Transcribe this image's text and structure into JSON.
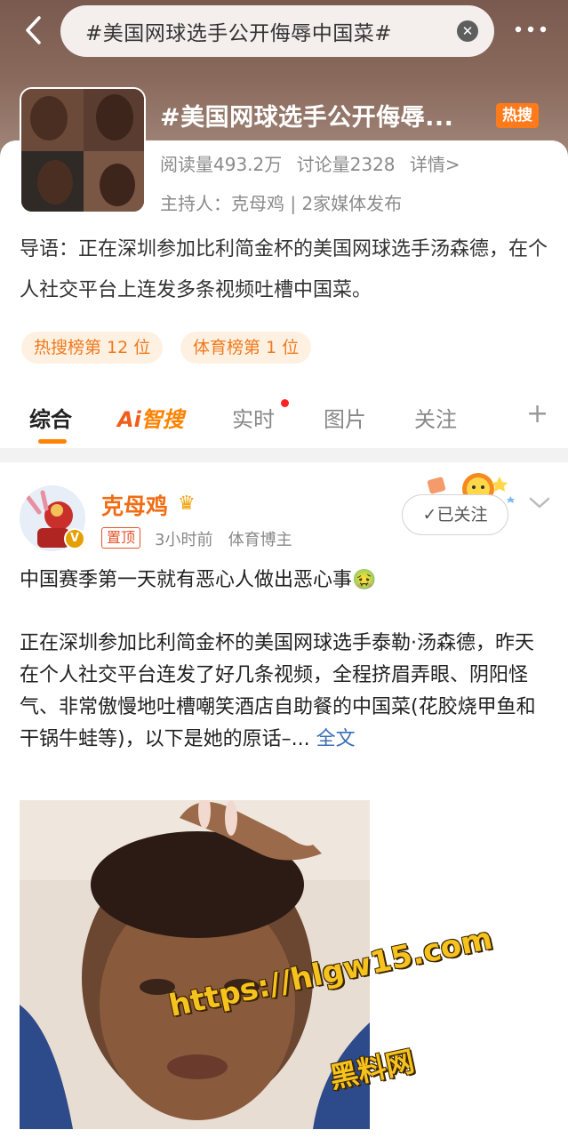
{
  "search": {
    "query": "#美国网球选手公开侮辱中国菜#",
    "clear_label": "✕"
  },
  "topic": {
    "title": "#美国网球选手公开侮辱...",
    "hot_badge": "热搜",
    "reads": "阅读量493.2万",
    "discussions": "讨论量2328",
    "details": "详情>",
    "host": "主持人：克母鸡 | 2家媒体发布",
    "intro": "导语：正在深圳参加比利简金杯的美国网球选手汤森德，在个人社交平台上连发多条视频吐槽中国菜。",
    "rank_tags": [
      "热搜榜第 12 位",
      "体育榜第 1 位"
    ]
  },
  "tabs": {
    "items": [
      "综合",
      "实时",
      "图片",
      "关注"
    ],
    "ai_label_a": "Ai",
    "ai_label_b": "智搜",
    "add": "+"
  },
  "post": {
    "author": "克母鸡",
    "pin": "置顶",
    "time": "3小时前",
    "role": "体育博主",
    "follow": "✓已关注",
    "line1": "中国赛季第一天就有恶心人做出恶心事🤢",
    "body": "正在深圳参加比利简金杯的美国网球选手泰勒·汤森德，昨天在个人社交平台连发了好几条视频，全程挤眉弄眼、阴阳怪气、非常傲慢地吐槽嘲笑酒店自助餐的中国菜(花胶烧甲鱼和干锅牛蛙等)，以下是她的原话–...",
    "more": "全文"
  },
  "watermark": {
    "url": "https://hlgw15.com",
    "name": "黑料网"
  }
}
